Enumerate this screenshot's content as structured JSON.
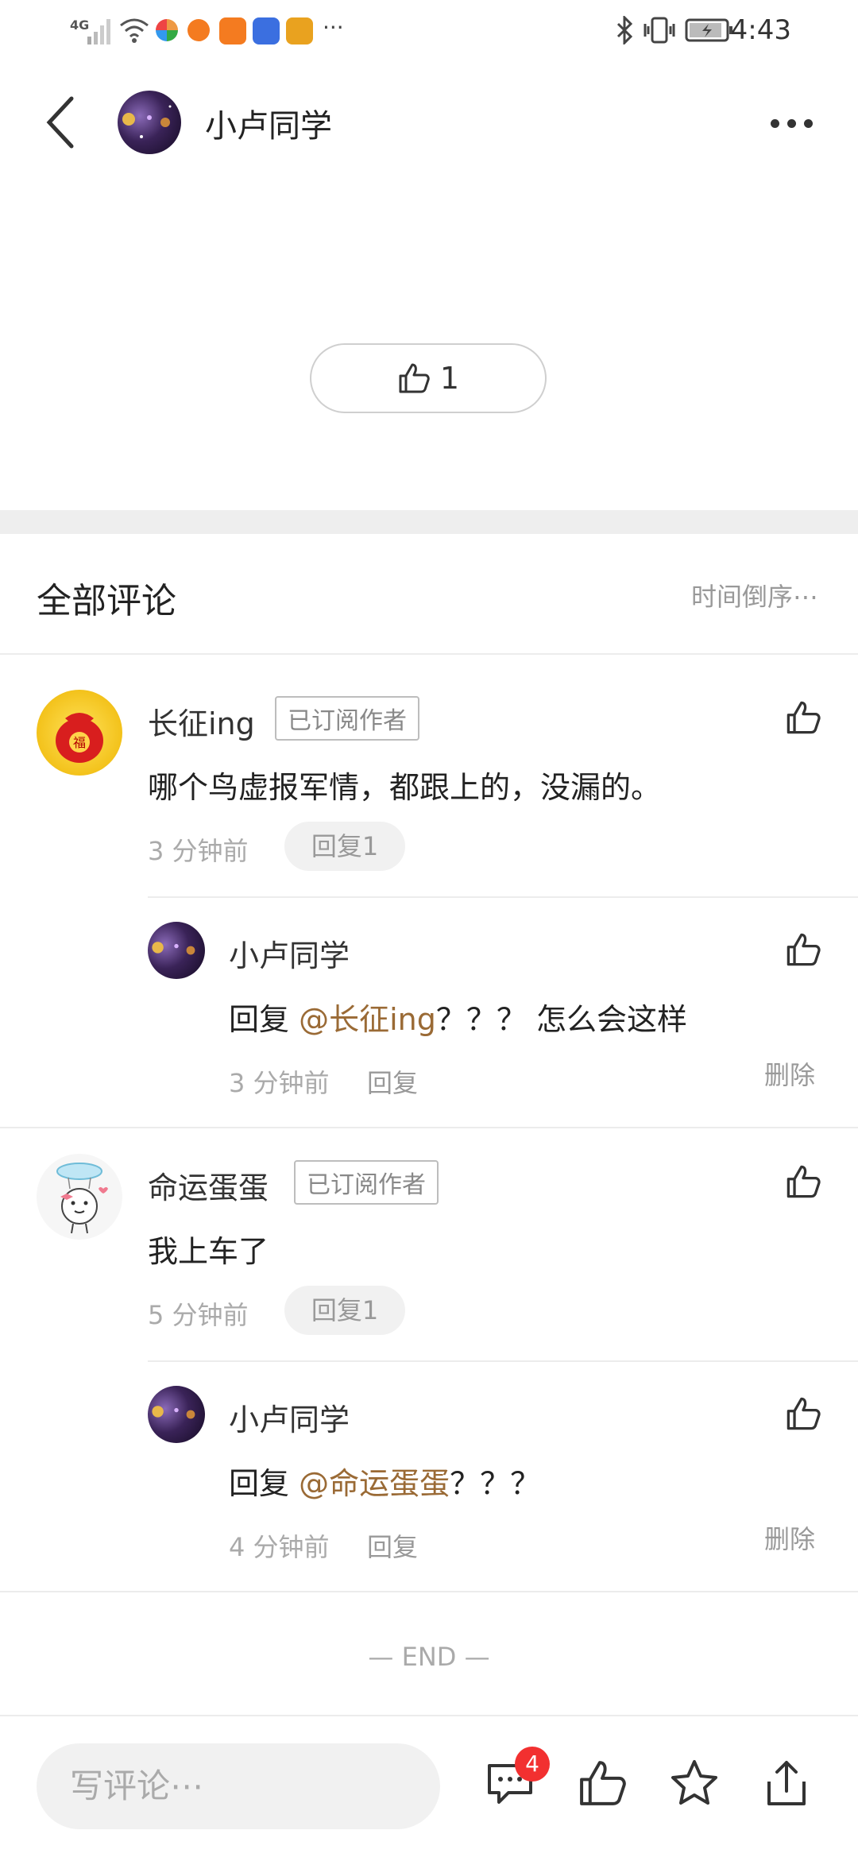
{
  "status_bar": {
    "network": "4G",
    "time": "4:43"
  },
  "header": {
    "title": "小卢同学"
  },
  "like_button": {
    "count": "1"
  },
  "comments_section": {
    "title": "全部评论",
    "sort_label": "时间倒序⋯",
    "comments": [
      {
        "author": "长征ing",
        "badge": "已订阅作者",
        "text": "哪个鸟虚报军情，都跟上的，没漏的。",
        "time": "3 分钟前",
        "reply_label": "回复1",
        "reply": {
          "author": "小卢同学",
          "prefix": "回复 ",
          "mention": "@长征ing",
          "text": "？？？ 怎么会这样",
          "time": "3 分钟前",
          "reply_label": "回复",
          "delete_label": "删除"
        }
      },
      {
        "author": "命运蛋蛋",
        "badge": "已订阅作者",
        "text": "我上车了",
        "time": "5 分钟前",
        "reply_label": "回复1",
        "reply": {
          "author": "小卢同学",
          "prefix": "回复 ",
          "mention": "@命运蛋蛋",
          "text": "？？？",
          "time": "4 分钟前",
          "reply_label": "回复",
          "delete_label": "删除"
        }
      }
    ],
    "end_label": "— END —"
  },
  "bottom_bar": {
    "input_placeholder": "写评论⋯",
    "comment_count_badge": "4",
    "icons": [
      "comment-icon",
      "thumbs-up-icon",
      "star-icon",
      "share-icon"
    ]
  },
  "colors": {
    "mention": "#9a6a35",
    "badge_red": "#f23030"
  }
}
